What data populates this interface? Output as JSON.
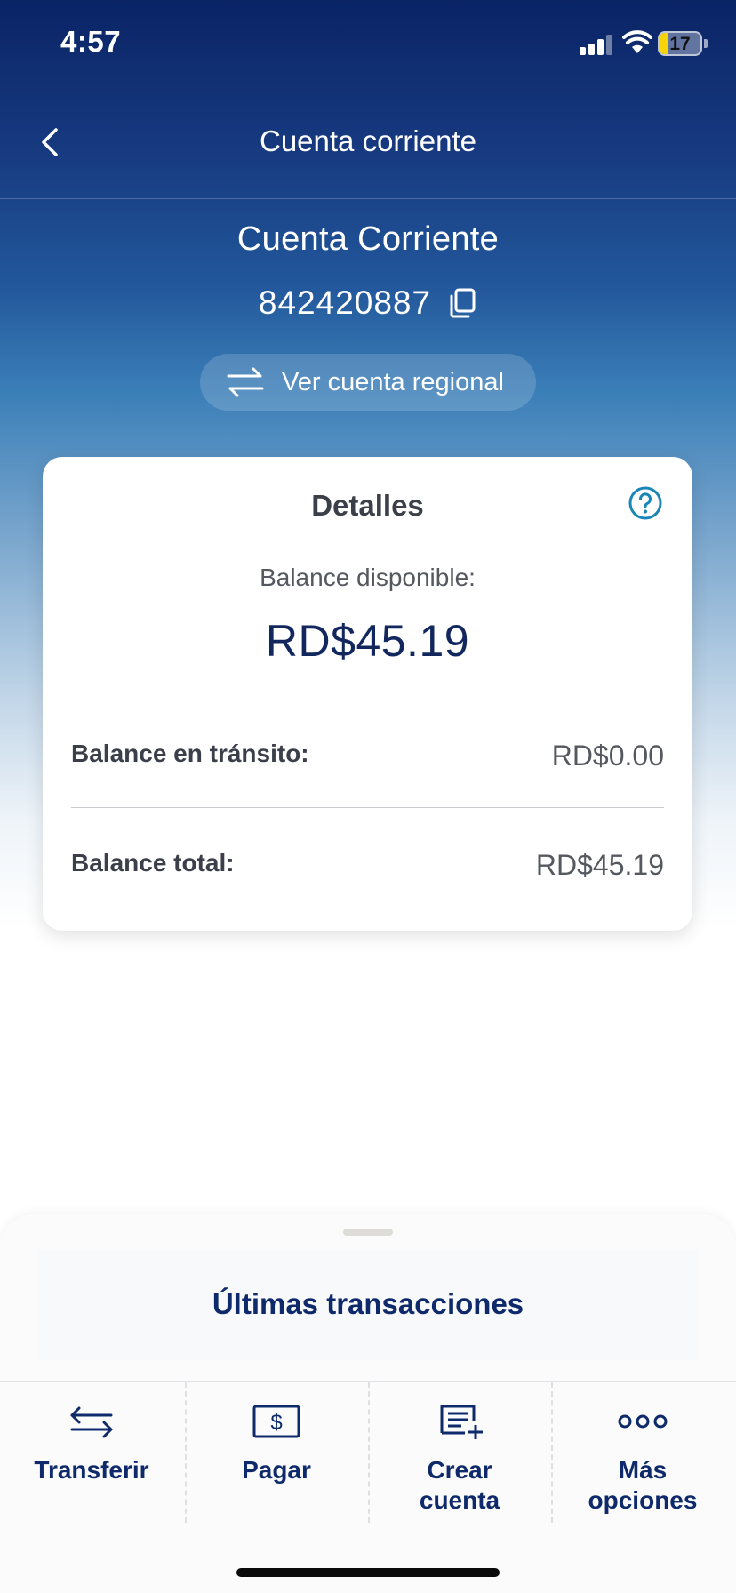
{
  "status_bar": {
    "time": "4:57",
    "battery": "17"
  },
  "nav": {
    "title": "Cuenta corriente",
    "back_icon": "chevron-left-icon"
  },
  "account": {
    "name": "Cuenta Corriente",
    "number": "842420887",
    "regional_label": "Ver cuenta regional"
  },
  "details": {
    "title": "Detalles",
    "available_label": "Balance disponible:",
    "available_amount": "RD$45.19",
    "transit_label": "Balance en tránsito:",
    "transit_amount": "RD$0.00",
    "total_label": "Balance total:",
    "total_amount": "RD$45.19"
  },
  "sheet": {
    "title": "Últimas transacciones"
  },
  "actions": [
    {
      "label": "Transferir",
      "icon": "transfer-icon"
    },
    {
      "label": "Pagar",
      "icon": "pay-icon"
    },
    {
      "label": "Crear cuenta",
      "icon": "create-account-icon"
    },
    {
      "label": "Más opciones",
      "icon": "more-options-icon"
    }
  ],
  "colors": {
    "primary": "#0e2a6b",
    "accent": "#1a86b8",
    "header": "#0a2466"
  }
}
